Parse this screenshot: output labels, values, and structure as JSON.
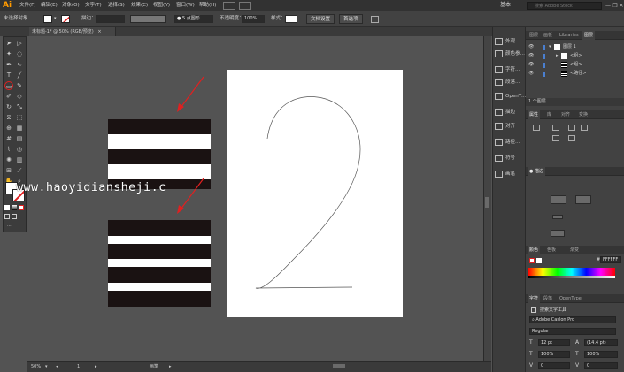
{
  "app": {
    "logo": "Ai",
    "menu": [
      "文件(F)",
      "编辑(E)",
      "对象(O)",
      "文字(T)",
      "选择(S)",
      "效果(C)",
      "视图(V)",
      "窗口(W)",
      "帮助(H)"
    ],
    "workspace": "基本",
    "search_placeholder": "搜索 Adobe Stock",
    "window_buttons": [
      "—",
      "❐",
      "✕"
    ]
  },
  "controlbar": {
    "no_selection": "未选择对象",
    "stroke_label": "描边：",
    "stroke_value": "",
    "brush": "5 点圆形",
    "opacity_label": "不透明度：",
    "opacity_value": "100%",
    "style_label": "样式：",
    "doc_setup": "文档设置",
    "preferences": "首选项"
  },
  "document": {
    "tab_title": "未标题-1* @ 50% (RGB/预览)",
    "tab_close": "×"
  },
  "watermark": "www.haoyidiansheji.c",
  "statusbar": {
    "zoom": "50%",
    "artboard": "1",
    "mode": "画笔"
  },
  "dock": {
    "items": [
      "外观",
      "颜色参…",
      "字符…",
      "段落…",
      "OpenT…",
      "描边",
      "对齐",
      "路径…",
      "符号",
      "画笔"
    ]
  },
  "layers_panel": {
    "tabs": [
      "图层",
      "画板",
      "Libraries",
      "图层"
    ],
    "rows": [
      {
        "name": "图层 1"
      },
      {
        "name": "<组>"
      },
      {
        "name": "<组>"
      },
      {
        "name": "<路径>"
      }
    ],
    "footer": "1 个图层"
  },
  "transform_panel": {
    "tabs": [
      "属性",
      "库",
      "对齐",
      "变换"
    ]
  },
  "stroke_panel": {
    "title": "描边"
  },
  "color_panel": {
    "tabs": [
      "颜色",
      "色板",
      "渐变"
    ],
    "hex": "FFFFFF"
  },
  "character_panel": {
    "tabs": [
      "字符",
      "段落",
      "OpenType"
    ],
    "search": "搜索文字工具",
    "font": "Adobe Caslon Pro",
    "style": "Regular",
    "size": "12 pt",
    "leading": "(14.4 pt)",
    "scale_v": "100%",
    "scale_h": "100%",
    "kerning": "0",
    "tracking": "0"
  },
  "colors": {
    "accent_circle": "#e02020",
    "arrow": "#e02020",
    "stripe_dark": "#1a1212"
  }
}
